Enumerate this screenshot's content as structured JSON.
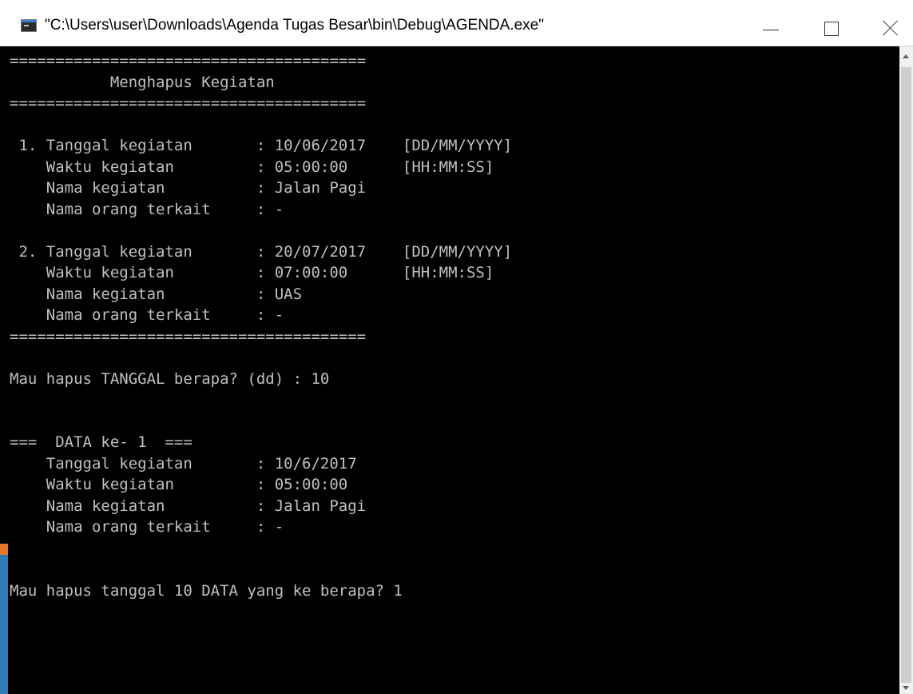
{
  "window": {
    "title": "\"C:\\Users\\user\\Downloads\\Agenda Tugas Besar\\bin\\Debug\\AGENDA.exe\""
  },
  "colors": {
    "console_background": "#000000",
    "console_text": "#c0c0c0",
    "titlebar_background": "#ffffff"
  },
  "icons": {
    "app": "console-app-icon",
    "minimize": "minimize-icon",
    "maximize": "maximize-icon",
    "close": "close-icon"
  },
  "console": {
    "lines": [
      "=======================================",
      "           Menghapus Kegiatan",
      "=======================================",
      "",
      " 1. Tanggal kegiatan       : 10/06/2017    [DD/MM/YYYY]",
      "    Waktu kegiatan         : 05:00:00      [HH:MM:SS]",
      "    Nama kegiatan          : Jalan Pagi",
      "    Nama orang terkait     : -",
      "",
      " 2. Tanggal kegiatan       : 20/07/2017    [DD/MM/YYYY]",
      "    Waktu kegiatan         : 07:00:00      [HH:MM:SS]",
      "    Nama kegiatan          : UAS",
      "    Nama orang terkait     : -",
      "=======================================",
      "",
      "Mau hapus TANGGAL berapa? (dd) : 10",
      "",
      "",
      "===  DATA ke- 1  ===",
      "    Tanggal kegiatan       : 10/6/2017",
      "    Waktu kegiatan         : 05:00:00",
      "    Nama kegiatan          : Jalan Pagi",
      "    Nama orang terkait     : -",
      "",
      "",
      "Mau hapus tanggal 10 DATA yang ke berapa? 1"
    ]
  }
}
